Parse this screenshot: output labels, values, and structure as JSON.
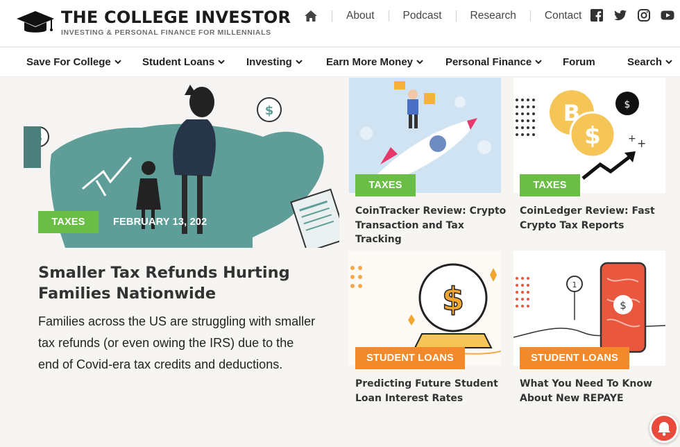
{
  "brand": {
    "name": "THE COLLEGE INVESTOR",
    "tagline": "INVESTING & PERSONAL FINANCE FOR MILLENNIALS"
  },
  "top_nav": {
    "items": [
      "About",
      "Podcast",
      "Research",
      "Contact"
    ]
  },
  "main_nav": {
    "items": [
      "Save For College",
      "Student Loans",
      "Investing",
      "Earn More Money",
      "Personal Finance",
      "Forum",
      "Search"
    ]
  },
  "feature": {
    "category": "TAXES",
    "date": "FEBRUARY 13, 202",
    "title": "Smaller Tax Refunds Hurting Families Nationwide",
    "excerpt": "Families across the US are struggling with smaller tax refunds (or even owing the IRS) due to the end of Covid-era tax credits and deductions."
  },
  "cards": [
    {
      "category": "TAXES",
      "title": "CoinTracker Review: Crypto Transaction and Tax Tracking"
    },
    {
      "category": "TAXES",
      "title": "CoinLedger Review: Fast Crypto Tax Reports"
    },
    {
      "category": "STUDENT LOANS",
      "title": "Predicting Future Student Loan Interest Rates"
    },
    {
      "category": "STUDENT LOANS",
      "title": "What You Need To Know About New REPAYE"
    }
  ],
  "colors": {
    "taxes_badge": "#6abe45",
    "student_loans_badge": "#f28a2c",
    "notification": "#e84a3b"
  }
}
